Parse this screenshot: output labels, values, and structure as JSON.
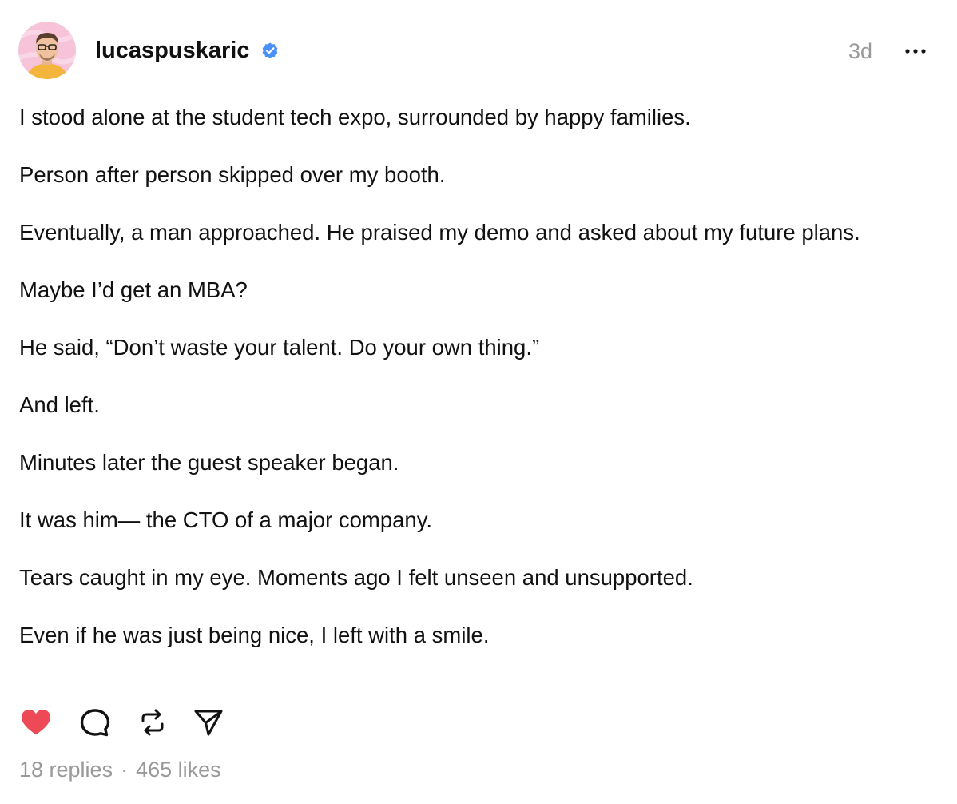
{
  "post": {
    "username": "lucaspuskaric",
    "verified": true,
    "timestamp": "3d",
    "paragraphs": [
      "I stood alone at the student tech expo, surrounded by happy families.",
      "Person after person skipped over my booth.",
      "Eventually, a man approached. He praised my demo and asked about my future plans.",
      "Maybe I’d get an MBA?",
      "He said, “Don’t waste your talent. Do your own thing.”",
      "And left.",
      "Minutes later the guest speaker began.",
      "It was him— the CTO of a major company.",
      "Tears caught in my eye. Moments ago I felt unseen and unsupported.",
      "Even if he was just being nice, I left with a smile."
    ],
    "liked": true,
    "replies": "18 replies",
    "separator": "·",
    "likes": "465 likes"
  },
  "icons": {
    "more": "more-horizontal-icon",
    "like": "heart-icon",
    "reply": "comment-bubble-icon",
    "repost": "repost-icon",
    "share": "send-icon",
    "verified": "verified-badge-icon"
  },
  "colors": {
    "like_red": "#ED4956",
    "verified_blue": "#4A90F7",
    "muted_text": "#999999",
    "text": "#111111",
    "avatar_bg": "#F7C3D9",
    "shirt": "#F3B53B"
  }
}
